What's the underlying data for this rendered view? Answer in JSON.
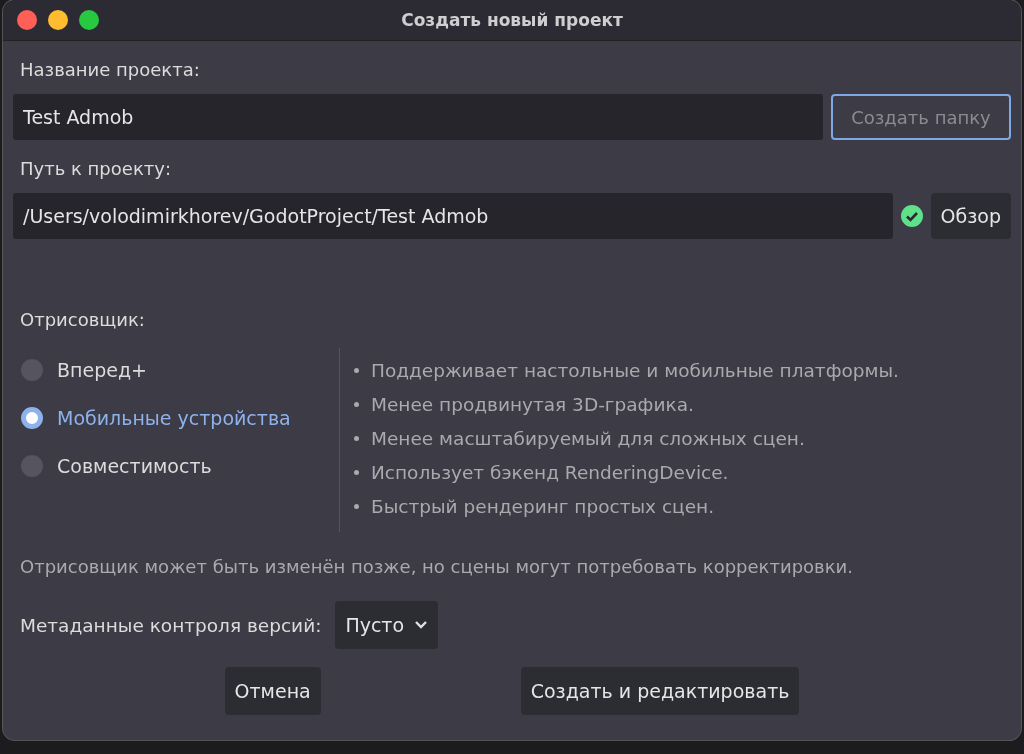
{
  "window": {
    "title": "Создать новый проект"
  },
  "project_name": {
    "label": "Название проекта:",
    "value": "Test Admob",
    "create_folder_button": {
      "label": "Создать папку",
      "disabled": true
    }
  },
  "project_path": {
    "label": "Путь к проекту:",
    "value": "/Users/volodimirkhorev/GodotProject/Test Admob",
    "valid": true,
    "browse_button": "Обзор"
  },
  "renderer": {
    "label": "Отрисовщик:",
    "options": [
      {
        "label": "Вперед+",
        "selected": false
      },
      {
        "label": "Мобильные устройства",
        "selected": true
      },
      {
        "label": "Совместимость",
        "selected": false
      }
    ],
    "features": [
      "Поддерживает настольные и мобильные платформы.",
      "Менее продвинутая 3D-графика.",
      "Менее масштабируемый для сложных сцен.",
      "Использует бэкенд RenderingDevice.",
      "Быстрый рендеринг простых сцен."
    ],
    "note": "Отрисовщик может быть изменён позже, но сцены могут потребовать корректировки."
  },
  "vcs": {
    "label": "Метаданные контроля версий:",
    "value": "Пусто"
  },
  "buttons": [
    {
      "label": "Отмена"
    },
    {
      "label": "Создать и редактировать"
    }
  ]
}
